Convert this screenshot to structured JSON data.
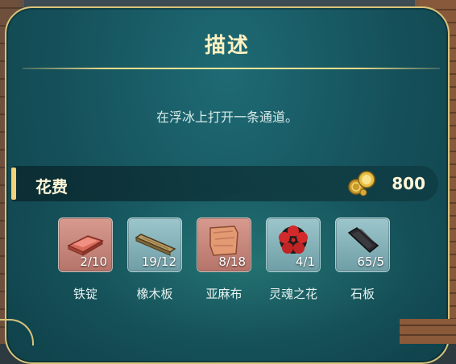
{
  "panel": {
    "title": "描述",
    "description": "在浮冰上打开一条通道。"
  },
  "cost": {
    "label": "花费",
    "icon": "gold-coins-icon",
    "value": "800"
  },
  "materials": [
    {
      "name": "铁锭",
      "count": "2/10",
      "icon": "iron-ingot-icon",
      "bg": "red"
    },
    {
      "name": "橡木板",
      "count": "19/12",
      "icon": "oak-plank-icon",
      "bg": "blue"
    },
    {
      "name": "亚麻布",
      "count": "8/18",
      "icon": "linen-cloth-icon",
      "bg": "red"
    },
    {
      "name": "灵魂之花",
      "count": "4/1",
      "icon": "soul-flower-icon",
      "bg": "blue"
    },
    {
      "name": "石板",
      "count": "65/5",
      "icon": "slate-icon",
      "bg": "blue"
    }
  ],
  "colors": {
    "accent_gold": "#f2d27a",
    "panel_teal": "#15505a",
    "insufficient_bg": "#c9877b",
    "sufficient_bg": "#8bb8be"
  }
}
